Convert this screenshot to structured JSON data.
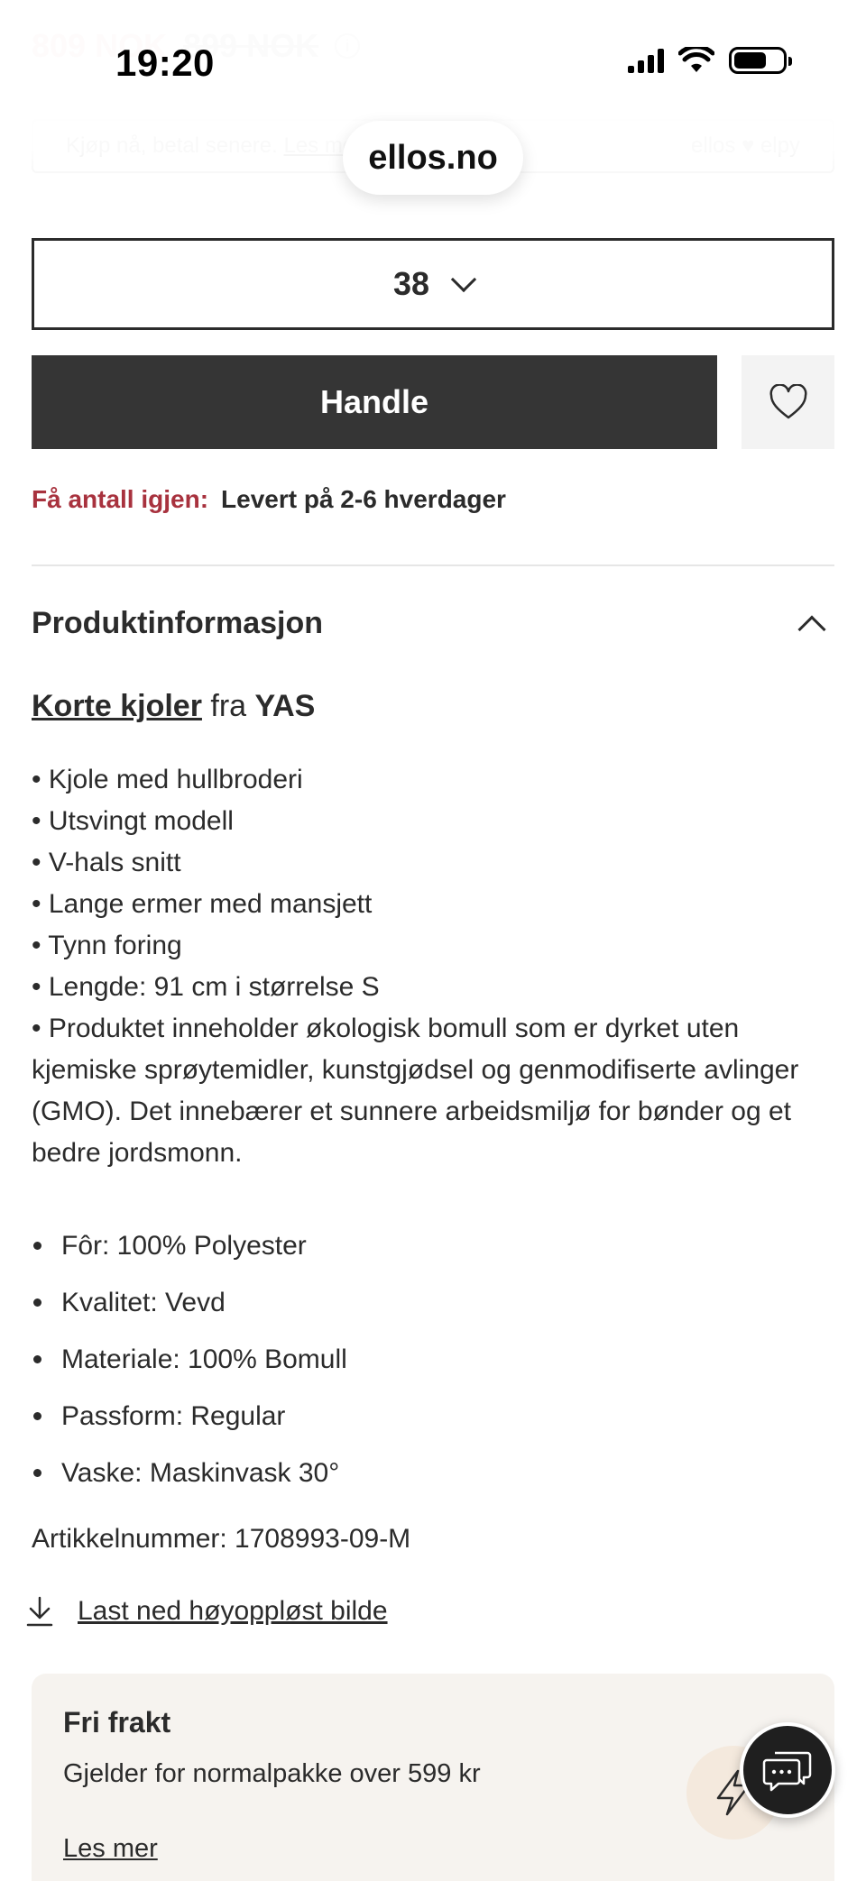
{
  "status_bar": {
    "time": "19:20"
  },
  "browser": {
    "url": "ellos.no"
  },
  "price": {
    "current": "809 NOK",
    "original": "899 NOK"
  },
  "bnpl": {
    "text": "Kjøp nå, betal senere.",
    "link": "Les mer",
    "provider": "ellos ♥ elpy"
  },
  "size_selector": {
    "selected": "38"
  },
  "buy_button": {
    "label": "Handle"
  },
  "stock": {
    "warning": "Få antall igjen:",
    "delivery": "Levert på 2-6 hverdager"
  },
  "product_info": {
    "title": "Produktinformasjon",
    "category_link": "Korte kjoler",
    "from": "fra",
    "brand": "YAS",
    "bullets": [
      "• Kjole med hullbroderi",
      "• Utsvingt modell",
      "• V-hals snitt",
      "• Lange ermer med mansjett",
      "• Tynn foring",
      "• Lengde: 91 cm i størrelse S",
      "• Produktet inneholder økologisk bomull som er dyrket uten kjemiske sprøytemidler, kunstgjødsel og genmodifiserte avlinger (GMO). Det innebærer et sunnere arbeidsmiljø for bønder og et bedre jordsmonn."
    ],
    "specs": [
      "Fôr: 100% Polyester",
      "Kvalitet: Vevd",
      "Materiale: 100% Bomull",
      "Passform: Regular",
      "Vaske: Maskinvask 30°"
    ],
    "article_number": "Artikkelnummer: 1708993-09-M",
    "download_label": "Last ned høyoppløst bilde"
  },
  "freight": {
    "title": "Fri frakt",
    "text": "Gjelder for normalpakke over 599 kr",
    "link": "Les mer"
  },
  "icons": {
    "chevron_down": "chevron-down-icon",
    "chevron_up": "chevron-up-icon",
    "heart": "heart-icon",
    "download": "download-icon",
    "bolt": "bolt-icon",
    "chat": "chat-icon",
    "info": "info-icon"
  }
}
